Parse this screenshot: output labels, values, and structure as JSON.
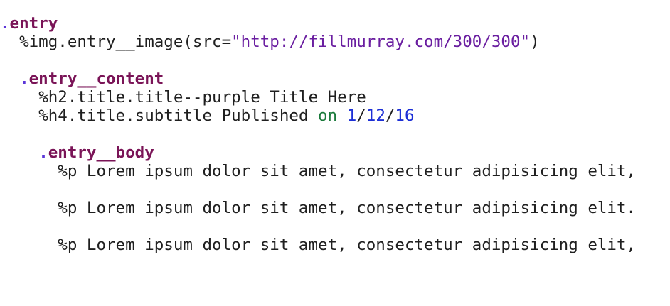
{
  "colors": {
    "background": "#ffffff",
    "text": "#1f1f1f",
    "class_selector": "#7a1457",
    "class_dot": "#5b35d8",
    "string": "#6a1ea0",
    "keyword": "#1a7a3b",
    "number": "#1c2fd6"
  },
  "code": {
    "line1": {
      "indent": "",
      "dot": ".",
      "class_name": "entry"
    },
    "line2": {
      "indent": "  ",
      "percent": "%",
      "tag": "img.entry__image(src=",
      "string": "\"http://fillmurray.com/300/300\"",
      "close": ")"
    },
    "line3": {
      "indent": "  ",
      "dot": ".",
      "class_name": "entry__content"
    },
    "line4": {
      "indent": "    ",
      "percent": "%",
      "tag": "h2.title.title--purple",
      "text": " Title Here"
    },
    "line5": {
      "indent": "    ",
      "percent": "%",
      "tag": "h4.title.subtitle",
      "text": " Published ",
      "keyword": "on",
      "space": " ",
      "num1": "1",
      "slash1": "/",
      "num2": "12",
      "slash2": "/",
      "num3": "16"
    },
    "line6": {
      "indent": "    ",
      "dot": ".",
      "class_name": "entry__body"
    },
    "line7": {
      "indent": "      ",
      "percent": "%",
      "tag": "p",
      "text": " Lorem ipsum dolor sit amet, consectetur adipisicing elit,"
    },
    "line8": {
      "indent": "      ",
      "percent": "%",
      "tag": "p",
      "text": " Lorem ipsum dolor sit amet, consectetur adipisicing elit."
    },
    "line9": {
      "indent": "      ",
      "percent": "%",
      "tag": "p",
      "text": " Lorem ipsum dolor sit amet, consectetur adipisicing elit,"
    }
  }
}
